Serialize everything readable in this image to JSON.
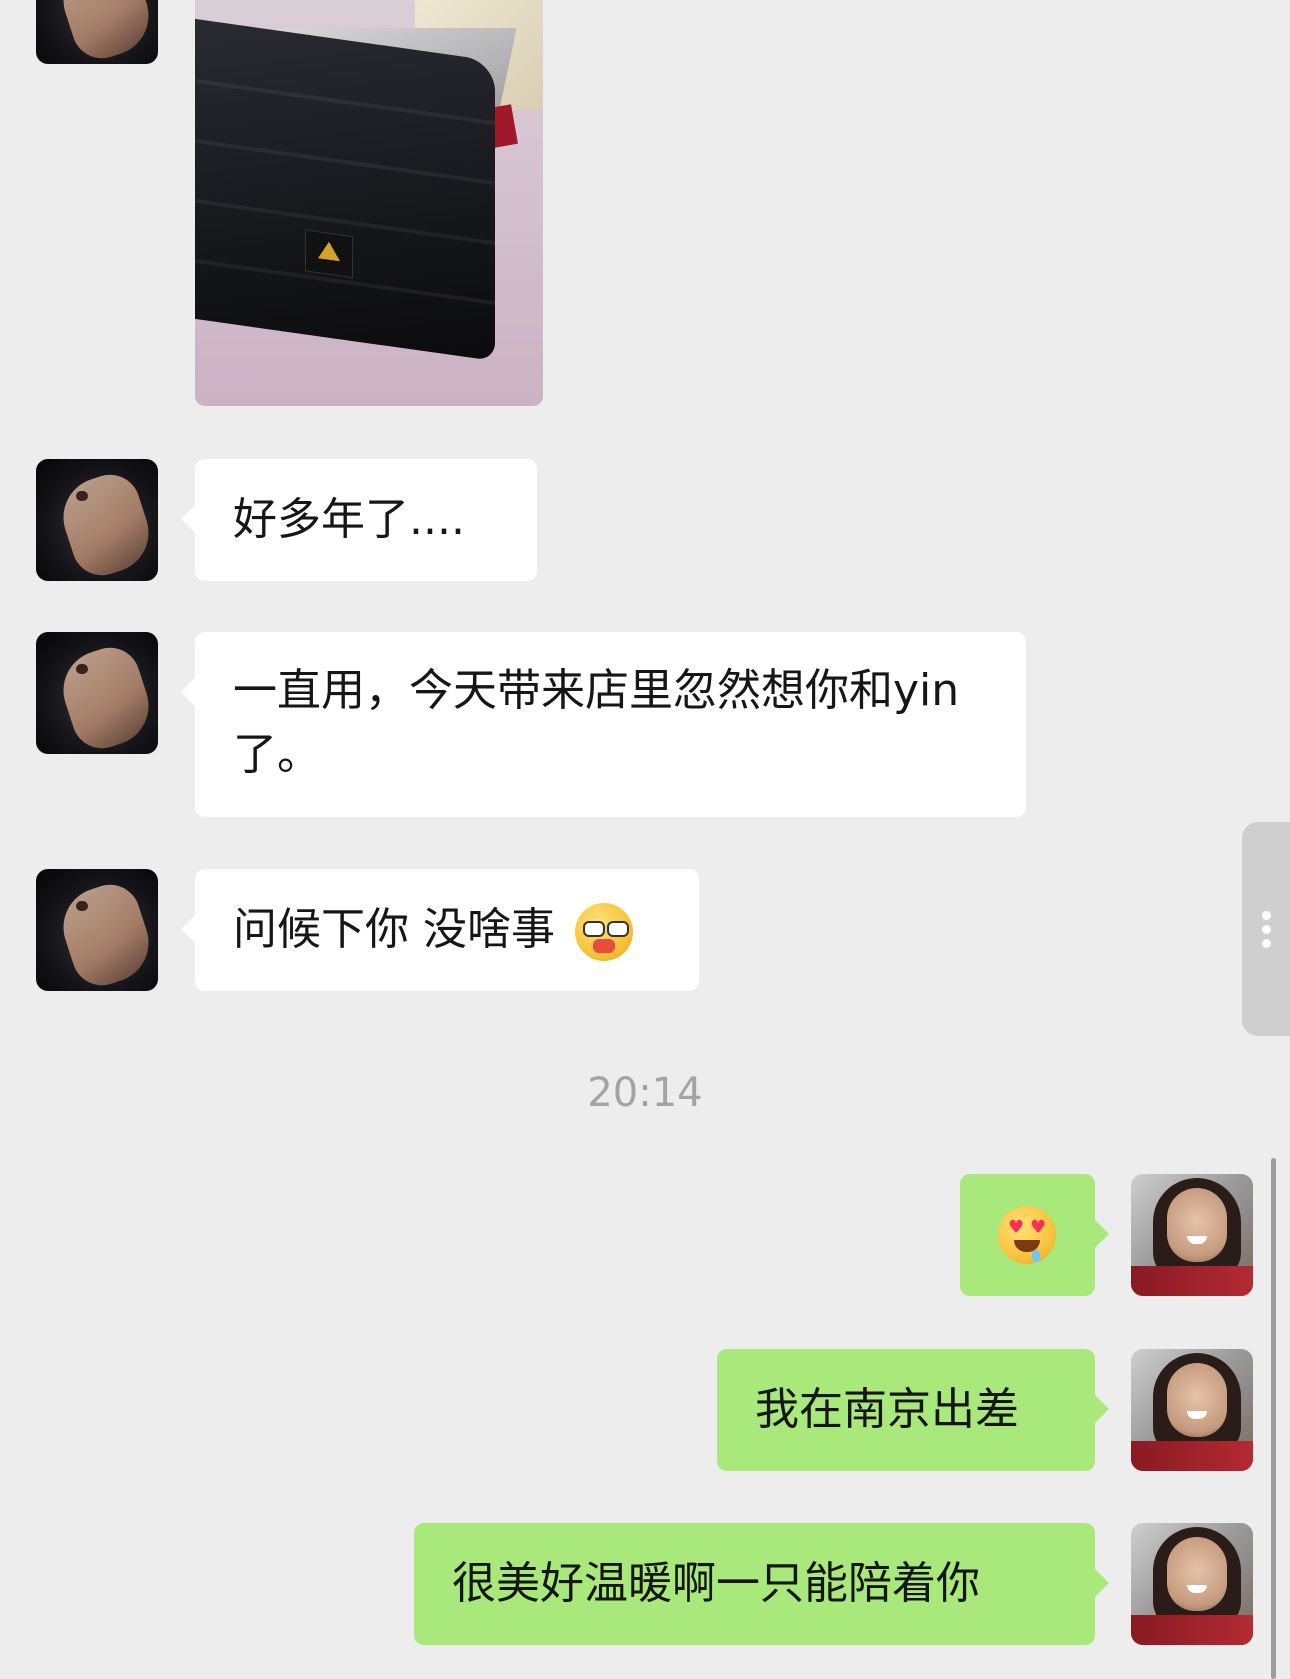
{
  "conversation": {
    "messages": [
      {
        "type": "image",
        "sender": "contact",
        "alt": ""
      },
      {
        "type": "text",
        "sender": "contact",
        "text": "好多年了...."
      },
      {
        "type": "text",
        "sender": "contact",
        "text": "一直用，今天带来店里忽然想你和yin了。"
      },
      {
        "type": "text",
        "sender": "contact",
        "text": "问候下你 没啥事"
      },
      {
        "type": "timestamp",
        "text": "20:14"
      },
      {
        "type": "emoji",
        "sender": "me",
        "emoji": "heart-eyes-drool"
      },
      {
        "type": "text",
        "sender": "me",
        "text": "我在南京出差"
      },
      {
        "type": "text",
        "sender": "me",
        "text": "很美好温暖啊一只能陪着你"
      }
    ]
  },
  "icons": {
    "contact_emoji": "face-with-glasses-eating",
    "more_handle": "vertical-dots"
  },
  "colors": {
    "background": "#ededed",
    "bubble_in": "#ffffff",
    "bubble_out": "#a9e87b",
    "timestamp": "#a3a3a3"
  }
}
